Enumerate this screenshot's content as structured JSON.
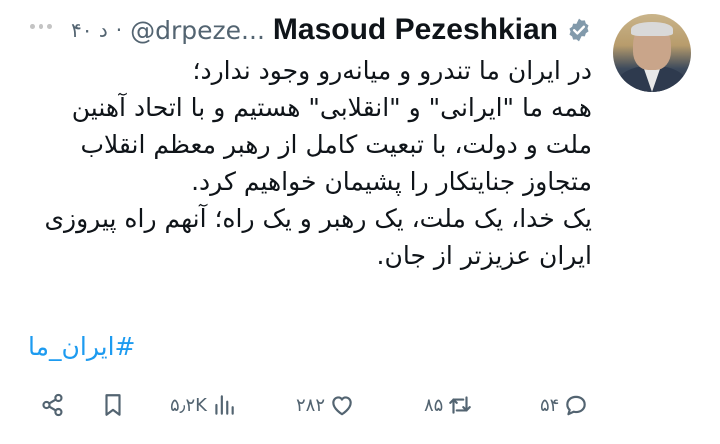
{
  "tweet": {
    "author_name": "Masoud Pezeshkian",
    "handle": "@drpeze...",
    "separator": "·",
    "time": "۴۰ د",
    "text_lines": [
      "در ایران ما تندرو و میانه‌رو وجود ندارد؛",
      "همه ما \"ایرانی\" و \"انقلابی\" هستیم و با اتحاد آهنین",
      "ملت و دولت، با تبعیت کامل از رهبر معظم انقلاب",
      "متجاوز جنایتکار را پشیمان خواهیم کرد.",
      "یک خدا، یک ملت، یک رهبر و یک راه؛ آنهم راه پیروزی",
      "ایران عزیزتر از جان."
    ],
    "hashtag": "#ایران_ما"
  },
  "actions": {
    "reply_count": "۵۴",
    "retweet_count": "۸۵",
    "like_count": "۲۸۲",
    "views_count": "۵٫۲K"
  },
  "icons": {
    "verified": "verified-badge-icon",
    "more": "more-options-icon",
    "reply": "reply-icon",
    "retweet": "retweet-icon",
    "like": "heart-icon",
    "views": "views-icon",
    "bookmark": "bookmark-icon",
    "share": "share-icon"
  },
  "colors": {
    "link": "#1d9bf0",
    "muted": "#536471",
    "text": "#0f1419"
  }
}
